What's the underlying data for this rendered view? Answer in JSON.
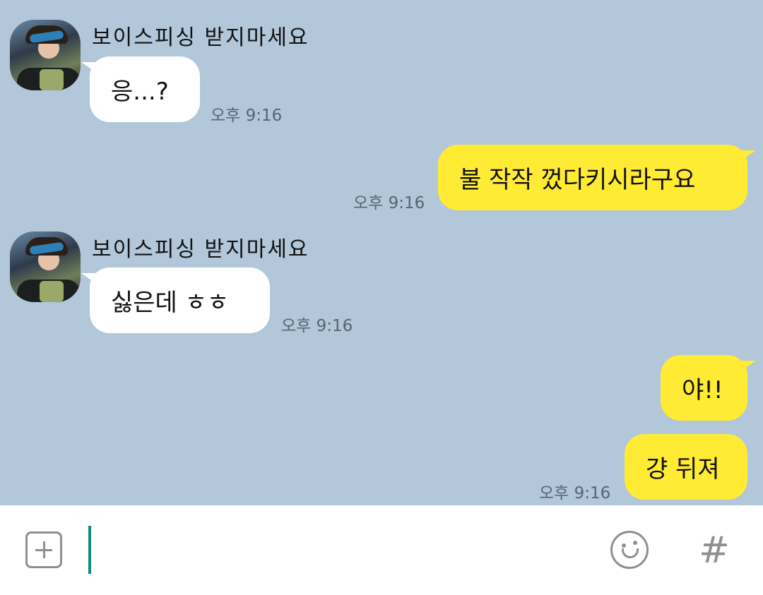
{
  "chat": {
    "messages": [
      {
        "side": "left",
        "sender": "보이스피싱 받지마세요",
        "text": "응...?",
        "time": "오후 9:16"
      },
      {
        "side": "right",
        "text": "불 작작 껐다키시라구요",
        "time": "오후 9:16"
      },
      {
        "side": "left",
        "sender": "보이스피싱 받지마세요",
        "text": "싫은데 ㅎㅎ",
        "time": "오후 9:16"
      },
      {
        "side": "right",
        "text": "야!!"
      },
      {
        "side": "right",
        "text": "걍 뒤져",
        "time": "오후 9:16"
      }
    ]
  },
  "input_bar": {
    "plus_icon": "plus-square-icon",
    "emoji_icon": "smile-icon",
    "hash_label": "#",
    "input_value": ""
  },
  "colors": {
    "chat_background": "#b2c7da",
    "my_bubble": "#ffeb33",
    "their_bubble": "#ffffff",
    "caret": "#138c7a",
    "icon_gray": "#8f8f8f"
  }
}
